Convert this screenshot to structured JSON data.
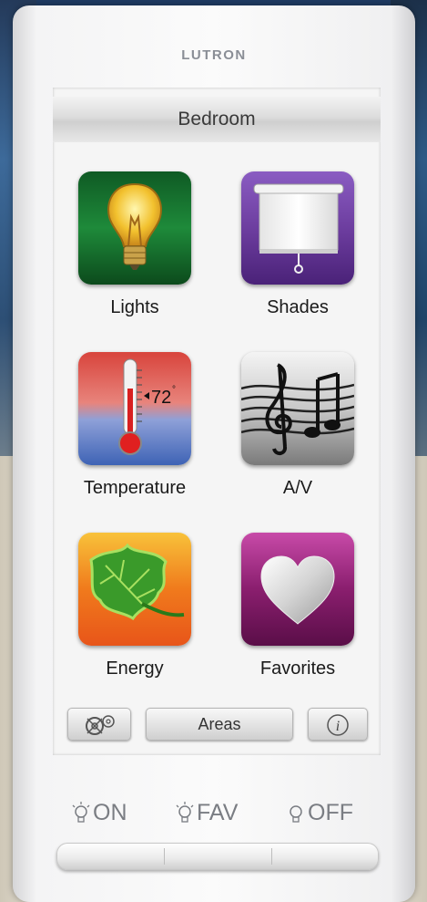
{
  "brand": "LUTRON",
  "screen": {
    "title": "Bedroom",
    "tiles": [
      {
        "label": "Lights",
        "icon": "light-bulb-icon"
      },
      {
        "label": "Shades",
        "icon": "window-shade-icon"
      },
      {
        "label": "Temperature",
        "icon": "thermometer-icon",
        "reading": "72"
      },
      {
        "label": "A/V",
        "icon": "music-notes-icon"
      },
      {
        "label": "Energy",
        "icon": "leaf-icon"
      },
      {
        "label": "Favorites",
        "icon": "heart-icon"
      }
    ],
    "bottom_bar": {
      "settings_icon": "gears-icon",
      "areas_label": "Areas",
      "info_glyph": "i"
    }
  },
  "hard_buttons": [
    {
      "label": "ON",
      "icon": "bulb-on-icon"
    },
    {
      "label": "FAV",
      "icon": "bulb-fav-icon"
    },
    {
      "label": "OFF",
      "icon": "bulb-off-icon"
    }
  ],
  "colors": {
    "lights_tile": "#1e8a3a",
    "shades_tile": "#6a3b9c",
    "temperature_top": "#d8443c",
    "temperature_bottom": "#3e63b5",
    "av_tile": "#9a9a9a",
    "energy_tile": "#f07a1c",
    "favorites_tile": "#8a1e6e"
  }
}
